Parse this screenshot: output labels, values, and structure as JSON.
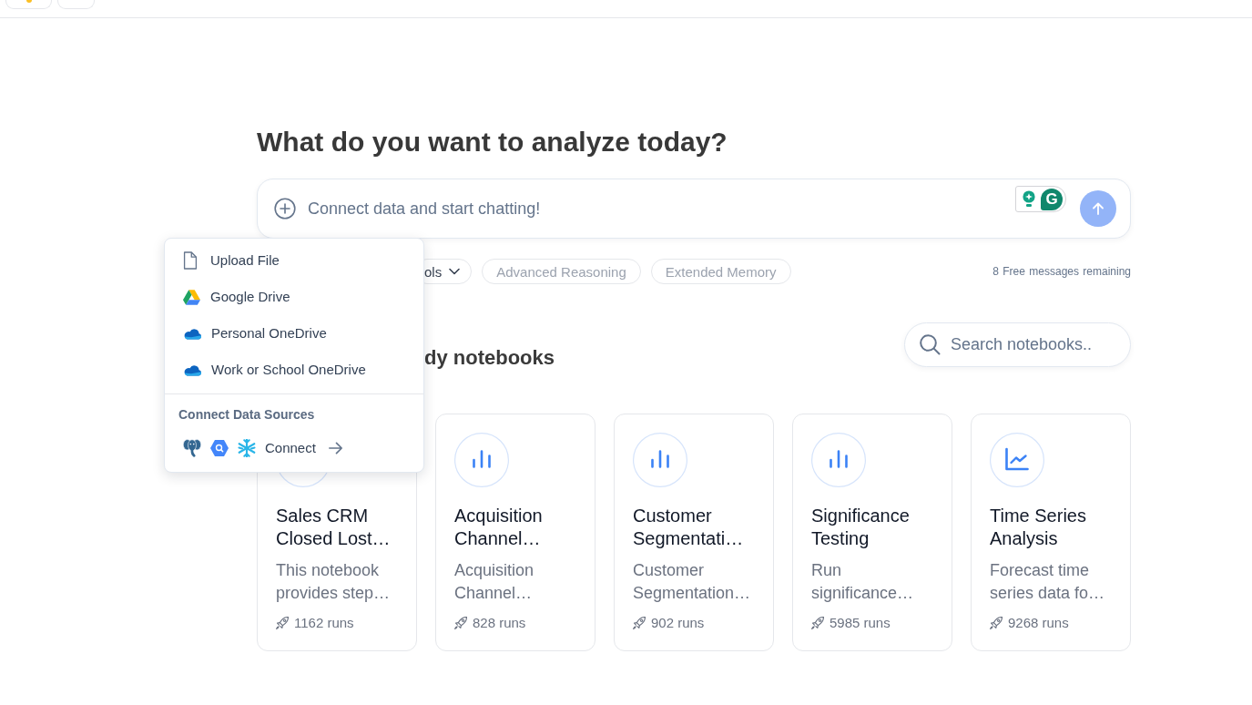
{
  "heading": "What do you want to analyze today?",
  "chat_input": {
    "placeholder": "Connect data and start chatting!",
    "extension_letter": "G"
  },
  "attach_menu": {
    "items": [
      {
        "label": "Upload File",
        "kind": "file"
      },
      {
        "label": "Google Drive",
        "kind": "drive"
      },
      {
        "label": "Personal OneDrive",
        "kind": "cloud"
      },
      {
        "label": "Work or School OneDrive",
        "kind": "cloud"
      }
    ],
    "section_title": "Connect Data Sources",
    "connect_label": "Connect"
  },
  "chips": [
    {
      "label": "ols",
      "kind": "dropdown"
    },
    {
      "label": "Advanced Reasoning",
      "kind": "option"
    },
    {
      "label": "Extended Memory",
      "kind": "option"
    }
  ],
  "messages_remaining": "8 Free messages remaining",
  "notebooks": {
    "title": "dy notebooks",
    "search": {
      "placeholder": "Search notebooks.."
    },
    "cards": [
      {
        "kind": "covered",
        "title": "Sales CRM Closed Lost…",
        "description": "This notebook provides step…",
        "runs": "1162 runs"
      },
      {
        "kind": "bar_chart",
        "title": "Acquisition Channel…",
        "description": "Acquisition Channel…",
        "runs": "828 runs"
      },
      {
        "kind": "bar_chart",
        "title": "Customer Segmentati…",
        "description": "Customer Segmentation…",
        "runs": "902 runs"
      },
      {
        "kind": "bar_chart",
        "title": "Significance Testing",
        "description": "Run significance…",
        "runs": "5985 runs"
      },
      {
        "kind": "line_chart",
        "title": "Time Series Analysis",
        "description": "Forecast time series data fo…",
        "runs": "9268 runs"
      }
    ]
  }
}
